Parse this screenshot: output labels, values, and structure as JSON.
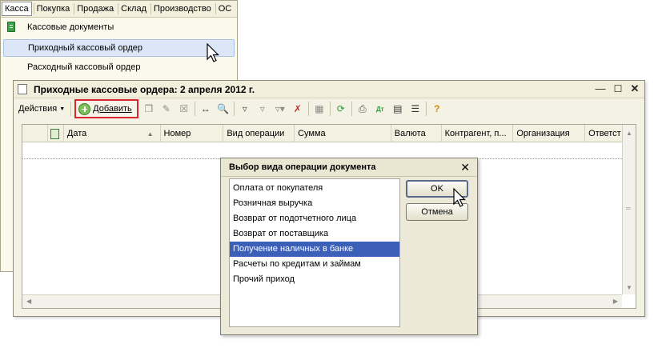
{
  "menubar": {
    "items": [
      "Касса",
      "Покупка",
      "Продажа",
      "Склад",
      "Производство",
      "ОС"
    ]
  },
  "submenu": {
    "items": [
      "Кассовые документы",
      "Приходный кассовый ордер",
      "Расходный кассовый ордер"
    ]
  },
  "list_window": {
    "title": "Приходные кассовые ордера: 2 апреля 2012 г.",
    "toolbar": {
      "actions_label": "Действия",
      "add_label": "Добавить"
    },
    "columns": [
      "Дата",
      "Номер",
      "Вид операции",
      "Сумма",
      "Валюта",
      "Контрагент, п...",
      "Организация",
      "Ответст"
    ]
  },
  "dialog": {
    "title": "Выбор вида операции документа",
    "options": [
      "Оплата от покупателя",
      "Розничная выручка",
      "Возврат от подотчетного лица",
      "Возврат от поставщика",
      "Получение наличных в банке",
      "Расчеты по кредитам и займам",
      "Прочий приход"
    ],
    "selected_index": 4,
    "ok_label": "OK",
    "cancel_label": "Отмена"
  },
  "colors": {
    "selection": "#3c5fb8",
    "add_highlight": "#d9262a",
    "menu_highlight": "#dbe7f6"
  }
}
